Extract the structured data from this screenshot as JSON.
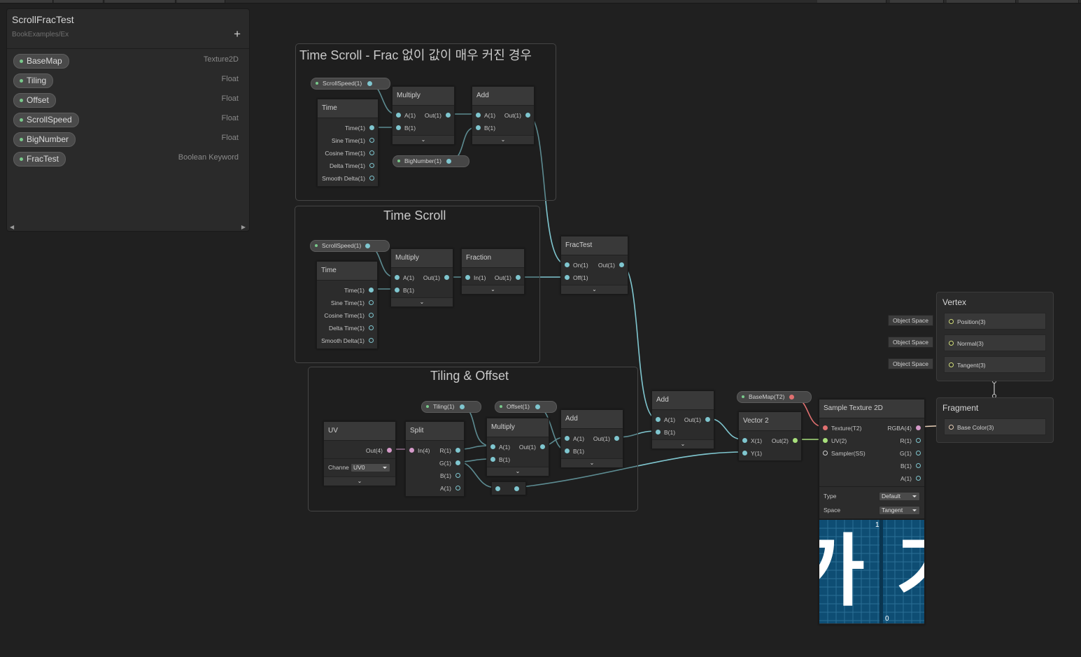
{
  "blackboard": {
    "title": "ScrollFracTest",
    "subtitle": "BookExamples/Ex",
    "add_label": "+",
    "properties": [
      {
        "name": "BaseMap",
        "type": "Texture2D"
      },
      {
        "name": "Tiling",
        "type": "Float"
      },
      {
        "name": "Offset",
        "type": "Float"
      },
      {
        "name": "ScrollSpeed",
        "type": "Float"
      },
      {
        "name": "BigNumber",
        "type": "Float"
      },
      {
        "name": "FracTest",
        "type": "Boolean Keyword"
      }
    ],
    "scroll_left": "◀",
    "scroll_right": "▶"
  },
  "groups": {
    "g1": "Time Scroll - Frac 없이 값이 매우 커진 경우",
    "g2": "Time Scroll",
    "g3": "Tiling & Offset"
  },
  "labels": {
    "time": "Time",
    "time_out": "Time(1)",
    "sine": "Sine Time(1)",
    "cosine": "Cosine Time(1)",
    "delta": "Delta Time(1)",
    "smooth": "Smooth Delta(1)",
    "multiply": "Multiply",
    "add": "Add",
    "a1": "A(1)",
    "b1": "B(1)",
    "out1": "Out(1)",
    "fraction": "Fraction",
    "in1": "In(1)",
    "fractest": "FracTest",
    "on1": "On(1)",
    "off1": "Off(1)",
    "uv": "UV",
    "out4": "Out(4)",
    "channel": "Channe",
    "channel_value": "UV0",
    "split": "Split",
    "in4": "In(4)",
    "r1": "R(1)",
    "g1": "G(1)",
    "b1s": "B(1)",
    "a1s": "A(1)",
    "vector2": "Vector 2",
    "x1": "X(1)",
    "y1": "Y(1)",
    "out2": "Out(2)",
    "sample": "Sample Texture 2D",
    "texture": "Texture(T2)",
    "uv2": "UV(2)",
    "sampler": "Sampler(SS)",
    "rgba": "RGBA(4)",
    "type": "Type",
    "type_value": "Default",
    "space": "Space",
    "space_value": "Tangent",
    "chevron": "⌄"
  },
  "props": {
    "scrollspeed": "ScrollSpeed(1)",
    "bignumber": "BigNumber(1)",
    "tiling": "Tiling(1)",
    "offset": "Offset(1)",
    "basemap": "BaseMap(T2)"
  },
  "master": {
    "vertex": "Vertex",
    "position": "Position(3)",
    "normal": "Normal(3)",
    "tangent": "Tangent(3)",
    "object_space": "Object Space",
    "fragment": "Fragment",
    "base_color": "Base Color(3)"
  },
  "preview": {
    "left_text": "가",
    "right_text": "가",
    "num_top": "1",
    "num_bottom": "0"
  },
  "colors": {
    "float_wire": "#7fc6cf",
    "vec2_wire": "#a8e07c",
    "vec4_wire": "#d59ac9",
    "tex_wire": "#e07070",
    "background": "#202020"
  }
}
